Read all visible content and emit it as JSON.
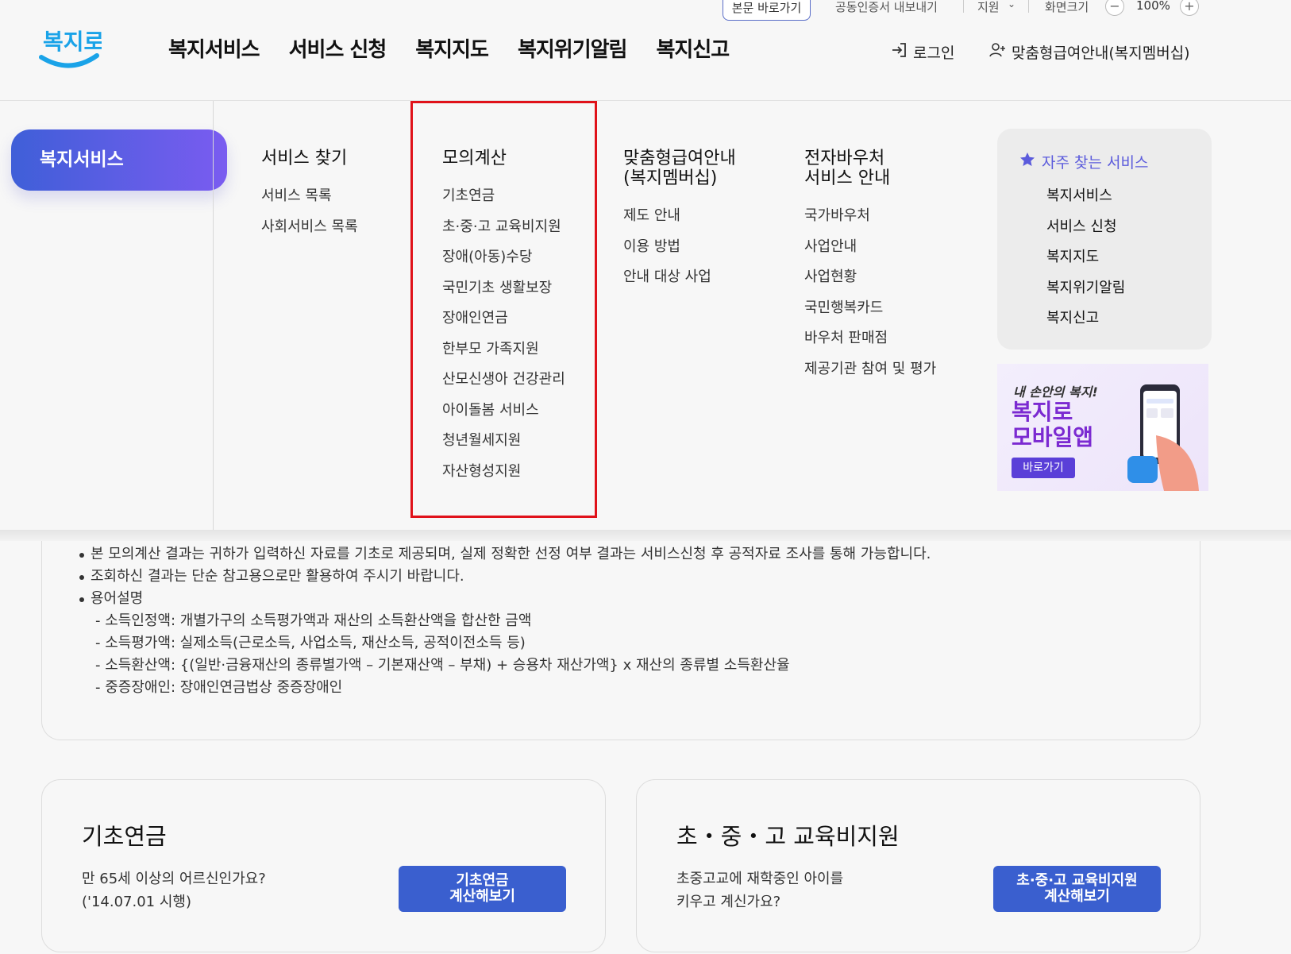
{
  "utility": {
    "skip": "본문 바로가기",
    "cert": "공동인증서 내보내기",
    "support": "지원",
    "zoom_label": "화면크기",
    "zoom_value": "100%"
  },
  "header": {
    "logo_text": "복지로",
    "nav": [
      "복지서비스",
      "서비스 신청",
      "복지지도",
      "복지위기알림",
      "복지신고"
    ],
    "login": "로그인",
    "membership": "맞춤형급여안내(복지멤버십)"
  },
  "mega": {
    "active": "복지서비스",
    "columns": [
      {
        "title": "서비스 찾기",
        "items": [
          "서비스 목록",
          "사회서비스 목록"
        ]
      },
      {
        "title": "모의계산",
        "items": [
          "기초연금",
          "초·중·고 교육비지원",
          "장애(아동)수당",
          "국민기초 생활보장",
          "장애인연금",
          "한부모 가족지원",
          "산모신생아 건강관리",
          "아이돌봄 서비스",
          "청년월세지원",
          "자산형성지원"
        ]
      },
      {
        "title_line1": "맞춤형급여안내",
        "title_line2": "(복지멤버십)",
        "items": [
          "제도 안내",
          "이용 방법",
          "안내 대상 사업"
        ]
      },
      {
        "title_line1": "전자바우처",
        "title_line2": "서비스 안내",
        "items": [
          "국가바우처",
          "사업안내",
          "사업현황",
          "국민행복카드",
          "바우처 판매점",
          "제공기관 참여 및 평가"
        ]
      }
    ],
    "favorites": {
      "title": "자주 찾는 서비스",
      "items": [
        "복지서비스",
        "서비스 신청",
        "복지지도",
        "복지위기알림",
        "복지신고"
      ]
    },
    "banner": {
      "line1": "내 손안의 복지!",
      "line2": "복지로",
      "line3": "모바일앱",
      "button": "바로가기"
    }
  },
  "notes": {
    "bullets": [
      "본 모의계산 결과는 귀하가 입력하신 자료를 기초로 제공되며, 실제 정확한 선정 여부 결과는 서비스신청 후 공적자료 조사를 통해 가능합니다.",
      "조회하신 결과는 단순 참고용으로만 활용하여 주시기 바랍니다.",
      "용어설명"
    ],
    "definitions": [
      "- 소득인정액: 개별가구의 소득평가액과 재산의 소득환산액을 합산한 금액",
      "- 소득평가액: 실제소득(근로소득, 사업소득, 재산소득, 공적이전소득 등)",
      "- 소득환산액: {(일반·금융재산의 종류별가액 – 기본재산액 – 부채) + 승용차 재산가액} x 재산의 종류별 소득환산율",
      "- 중증장애인: 장애인연금법상 중증장애인"
    ]
  },
  "cards": [
    {
      "title": "기초연금",
      "desc": "만 65세 이상의 어르신인가요?\n('14.07.01 시행)",
      "button": "기초연금\n계산해보기"
    },
    {
      "title": "초・중・고 교육비지원",
      "desc": "초중고교에 재학중인 아이를\n키우고 계신가요?",
      "button": "초·중·고 교육비지원\n계산해보기"
    }
  ],
  "colors": {
    "accent": "#3a5fcf",
    "highlight": "#e0121a",
    "purple": "#5b5bdc"
  }
}
